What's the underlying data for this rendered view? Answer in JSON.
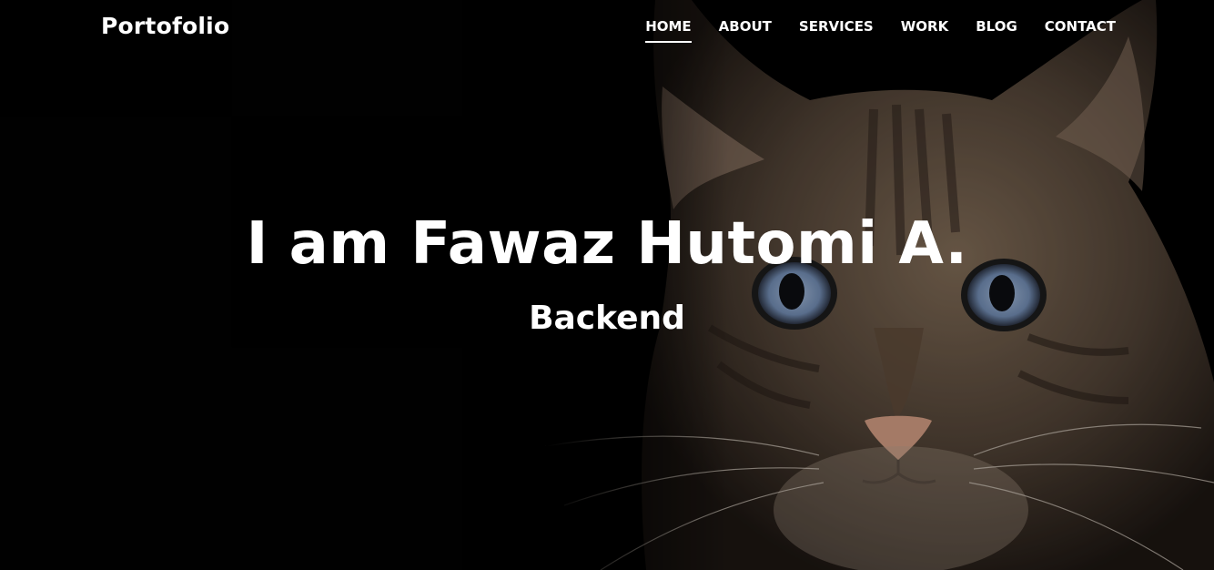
{
  "brand": {
    "label": "Portofolio"
  },
  "nav": {
    "items": [
      {
        "label": "HOME",
        "active": true
      },
      {
        "label": "ABOUT",
        "active": false
      },
      {
        "label": "SERVICES",
        "active": false
      },
      {
        "label": "WORK",
        "active": false
      },
      {
        "label": "BLOG",
        "active": false
      },
      {
        "label": "CONTACT",
        "active": false
      }
    ]
  },
  "hero": {
    "title": "I am Fawaz Hutomi A.",
    "subtitle": "Backend",
    "background": "cat-photo"
  },
  "colors": {
    "background": "#010101",
    "text": "#ffffff",
    "fur": "#6b5a49",
    "eye": "#7f96b6",
    "nose": "#c9957d"
  }
}
